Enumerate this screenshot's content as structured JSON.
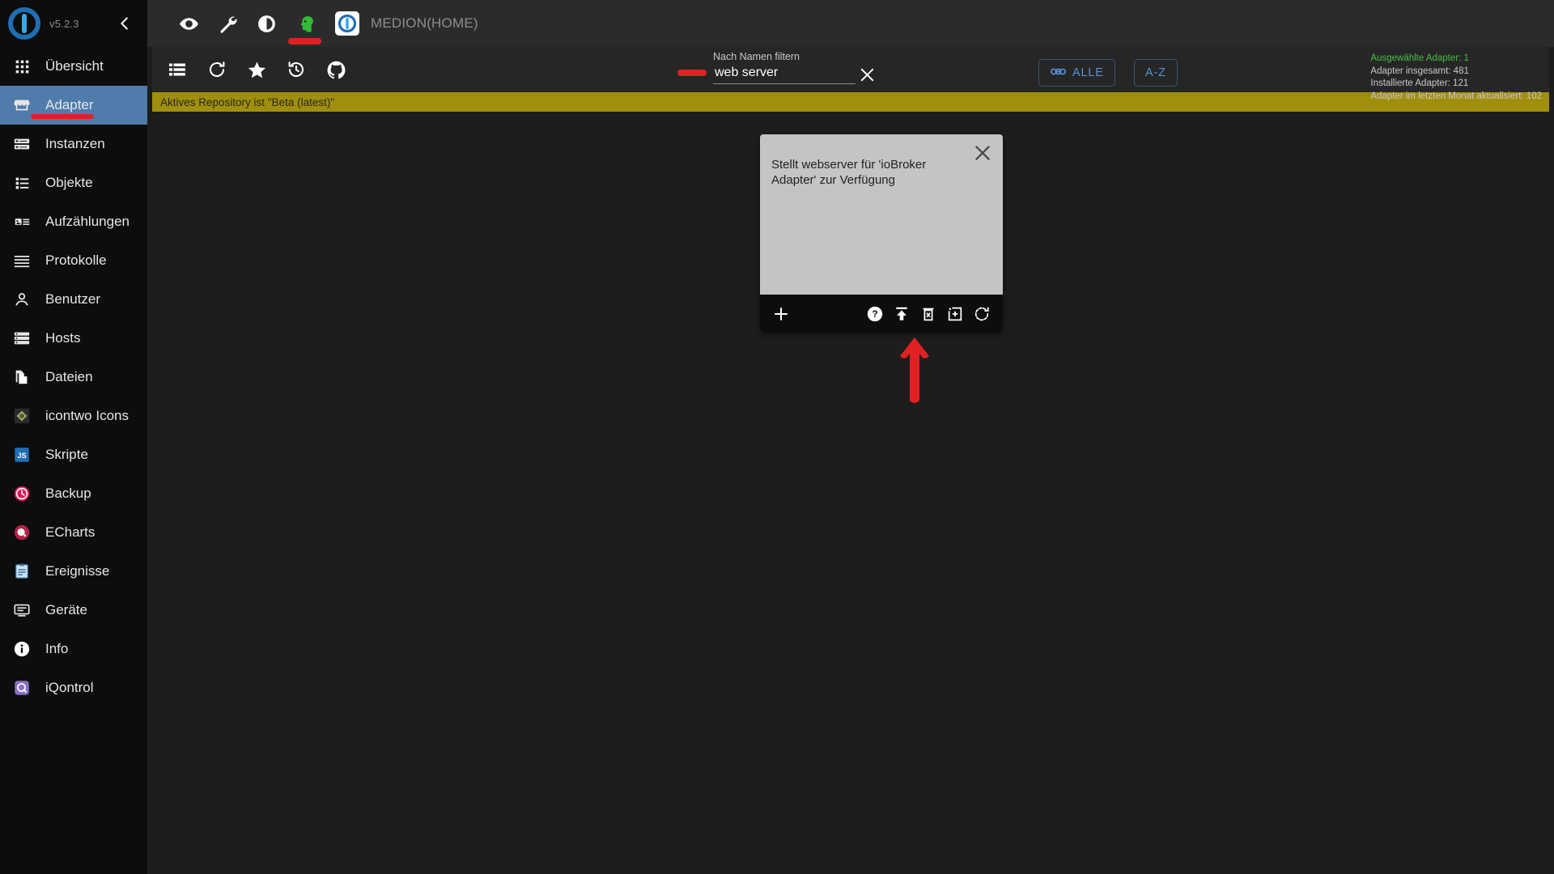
{
  "sidebar": {
    "version": "v5.2.3",
    "collapse_icon": "chevron-left-icon",
    "items": [
      {
        "label": "Übersicht",
        "icon": "grid-icon",
        "active": false
      },
      {
        "label": "Adapter",
        "icon": "store-icon",
        "active": true
      },
      {
        "label": "Instanzen",
        "icon": "instances-icon",
        "active": false
      },
      {
        "label": "Objekte",
        "icon": "list-icon",
        "active": false
      },
      {
        "label": "Aufzählungen",
        "icon": "enum-icon",
        "active": false
      },
      {
        "label": "Protokolle",
        "icon": "logs-icon",
        "active": false
      },
      {
        "label": "Benutzer",
        "icon": "person-icon",
        "active": false
      },
      {
        "label": "Hosts",
        "icon": "hosts-icon",
        "active": false
      },
      {
        "label": "Dateien",
        "icon": "files-icon",
        "active": false
      },
      {
        "label": "icontwo Icons",
        "icon": "icontwo-icon",
        "active": false
      },
      {
        "label": "Skripte",
        "icon": "javascript-icon",
        "active": false
      },
      {
        "label": "Backup",
        "icon": "backup-icon",
        "active": false
      },
      {
        "label": "ECharts",
        "icon": "echarts-icon",
        "active": false
      },
      {
        "label": "Ereignisse",
        "icon": "events-icon",
        "active": false
      },
      {
        "label": "Geräte",
        "icon": "devices-icon",
        "active": false
      },
      {
        "label": "Info",
        "icon": "info-icon",
        "active": false
      },
      {
        "label": "iQontrol",
        "icon": "iqontrol-icon",
        "active": false
      }
    ]
  },
  "topbar": {
    "icons": [
      {
        "name": "eye-icon"
      },
      {
        "name": "wrench-icon"
      },
      {
        "name": "theme-contrast-icon"
      },
      {
        "name": "expert-mode-head-icon"
      }
    ],
    "host_logo_icon": "iobroker-logo-icon",
    "host_name": "MEDION(HOME)"
  },
  "toolbar": {
    "icons": [
      {
        "name": "list-view-icon"
      },
      {
        "name": "refresh-icon"
      },
      {
        "name": "star-icon"
      },
      {
        "name": "update-history-icon"
      },
      {
        "name": "github-icon"
      }
    ],
    "search": {
      "label": "Nach Namen filtern",
      "value": "web server",
      "placeholder": "Nach Namen filtern",
      "clear_icon": "close-icon"
    },
    "buttons": [
      {
        "label": "ALLE",
        "icon": "infinity-icon"
      },
      {
        "label": "A-Z",
        "icon": ""
      }
    ]
  },
  "stats": {
    "selected": "Ausgewählte Adapter: 1",
    "total": "Adapter insgesamt: 481",
    "installed": "Installierte Adapter: 121",
    "updated_last_month": "Adapter im letzten Monat aktualisiert: 102"
  },
  "banner": {
    "text": "Aktives Repository ist \"Beta (latest)\""
  },
  "card": {
    "description": "Stellt webserver für 'ioBroker Adapter' zur Verfügung",
    "close_icon": "close-icon",
    "footer_icons": [
      {
        "name": "add-instance-plus-icon",
        "side": "left"
      },
      {
        "name": "help-question-icon",
        "side": "right"
      },
      {
        "name": "upload-upgrade-icon",
        "side": "right"
      },
      {
        "name": "delete-trash-icon",
        "side": "right"
      },
      {
        "name": "install-box-plus-icon",
        "side": "right"
      },
      {
        "name": "rebuild-refresh-icon",
        "side": "right"
      }
    ]
  },
  "annotations": {
    "arrow": "red-up-arrow",
    "colors": {
      "accent_red": "#e12121",
      "active_blue": "#4f7cab",
      "banner_yellow": "#a08e0f",
      "link_blue": "#5a92d6",
      "green_text": "#4bbd4b"
    }
  }
}
